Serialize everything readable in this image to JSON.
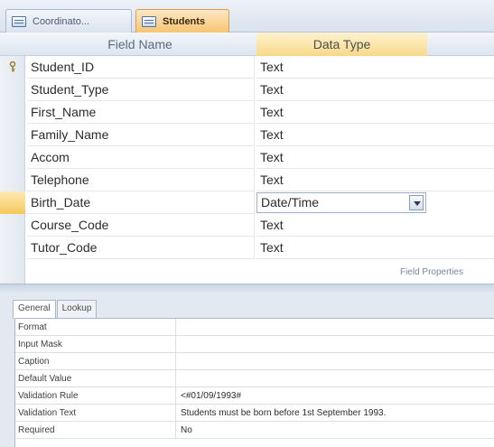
{
  "tabs": [
    {
      "label": "Coordinato...",
      "active": false
    },
    {
      "label": "Students",
      "active": true
    }
  ],
  "grid": {
    "headers": {
      "field_name": "Field Name",
      "data_type": "Data Type"
    },
    "rows": [
      {
        "field": "Student_ID",
        "type": "Text",
        "primary_key": true
      },
      {
        "field": "Student_Type",
        "type": "Text"
      },
      {
        "field": "First_Name",
        "type": "Text"
      },
      {
        "field": "Family_Name",
        "type": "Text"
      },
      {
        "field": "Accom",
        "type": "Text"
      },
      {
        "field": "Telephone",
        "type": "Text"
      },
      {
        "field": "Birth_Date",
        "type": "Date/Time",
        "selected": true
      },
      {
        "field": "Course_Code",
        "type": "Text"
      },
      {
        "field": "Tutor_Code",
        "type": "Text"
      }
    ],
    "field_properties_label": "Field Properties"
  },
  "properties": {
    "tabs": [
      "General",
      "Lookup"
    ],
    "active_tab": "General",
    "rows": [
      {
        "label": "Format",
        "value": ""
      },
      {
        "label": "Input Mask",
        "value": ""
      },
      {
        "label": "Caption",
        "value": ""
      },
      {
        "label": "Default Value",
        "value": ""
      },
      {
        "label": "Validation Rule",
        "value": "<#01/09/1993#"
      },
      {
        "label": "Validation Text",
        "value": "Students must be born before 1st September 1993."
      },
      {
        "label": "Required",
        "value": "No"
      }
    ]
  },
  "colors": {
    "selected_accent": "#f6c85b",
    "header_bg": "#dde5ef"
  },
  "icons": {
    "tab": "table-icon",
    "primary_key": "key-icon",
    "dropdown": "chevron-down-icon"
  }
}
